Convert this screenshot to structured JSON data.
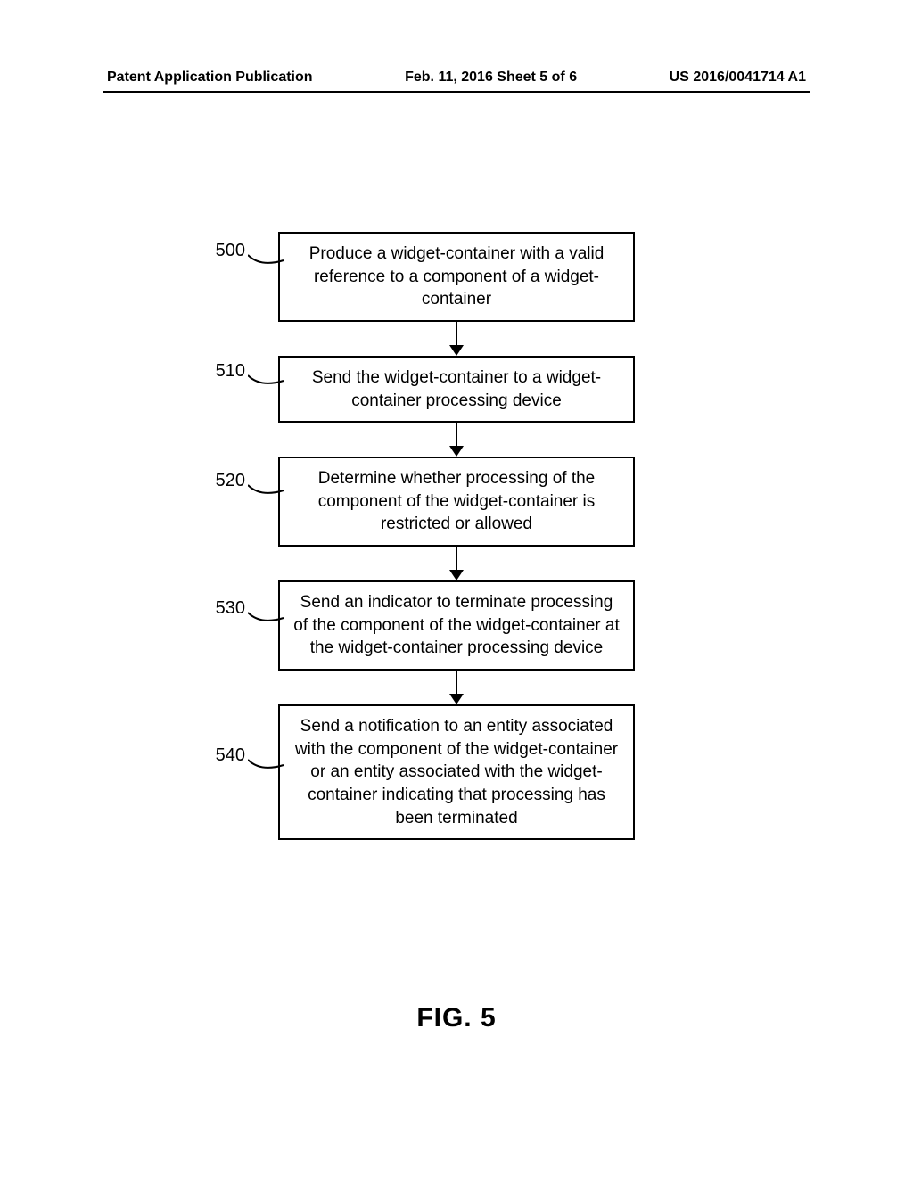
{
  "header": {
    "left": "Patent Application Publication",
    "center": "Feb. 11, 2016  Sheet 5 of 6",
    "right": "US 2016/0041714 A1"
  },
  "flowchart": {
    "steps": [
      {
        "ref": "500",
        "text": "Produce a widget-container with a valid reference to a component of a widget-container"
      },
      {
        "ref": "510",
        "text": "Send the widget-container to a widget-container processing device"
      },
      {
        "ref": "520",
        "text": "Determine whether processing of the component of the widget-container is restricted or allowed"
      },
      {
        "ref": "530",
        "text": "Send an indicator to terminate processing of the component of the widget-container at the widget-container processing device"
      },
      {
        "ref": "540",
        "text": "Send a notification to an entity associated with the component of the widget-container or an entity associated with the widget-container indicating that processing has been terminated"
      }
    ]
  },
  "figure_label": "FIG. 5"
}
